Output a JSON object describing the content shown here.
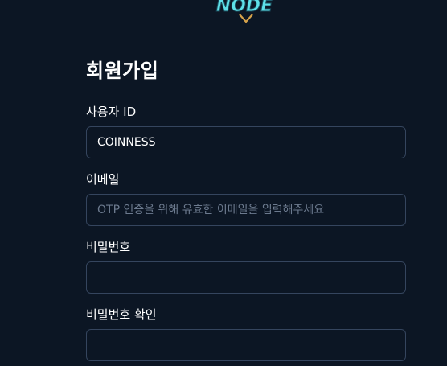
{
  "logo": {
    "text": "NODE",
    "colors": {
      "primary": "#5ee0e8",
      "outline": "#1a4a5a",
      "accent": "#d6a24a"
    }
  },
  "form": {
    "title": "회원가입",
    "fields": [
      {
        "label": "사용자 ID",
        "value": "COINNESS",
        "placeholder": ""
      },
      {
        "label": "이메일",
        "value": "",
        "placeholder": "OTP 인증을 위해 유효한 이메일을 입력해주세요"
      },
      {
        "label": "비밀번호",
        "value": "",
        "placeholder": ""
      },
      {
        "label": "비밀번호 확인",
        "value": "",
        "placeholder": ""
      }
    ]
  },
  "colors": {
    "background": "#0c1624",
    "input_border": "#35455e",
    "placeholder": "#6c7a8e",
    "text": "#ffffff"
  }
}
